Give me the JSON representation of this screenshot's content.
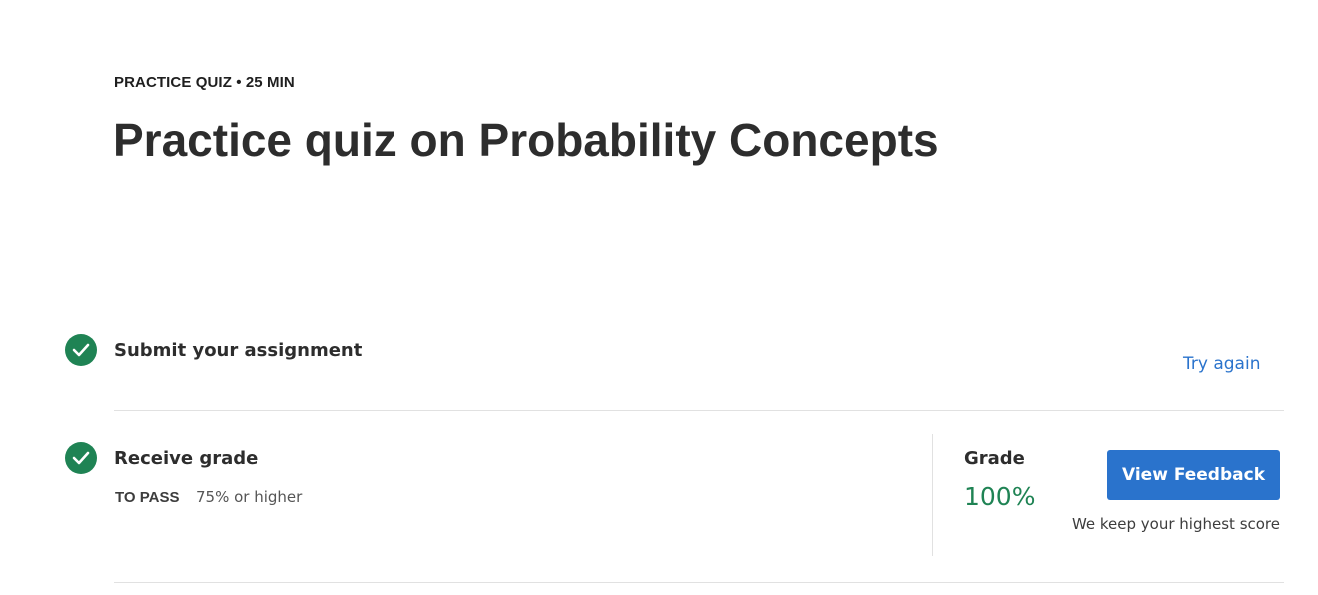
{
  "header": {
    "meta": "PRACTICE QUIZ • 25 MIN",
    "title": "Practice quiz on Probability Concepts"
  },
  "steps": [
    {
      "title": "Submit your assignment",
      "status_icon": "check-circle-icon",
      "action_label": "Try again"
    },
    {
      "title": "Receive grade",
      "status_icon": "check-circle-icon",
      "pass_label": "TO PASS",
      "pass_value": "75% or higher"
    }
  ],
  "grade": {
    "label": "Grade",
    "value": "100%",
    "button_label": "View Feedback",
    "note": "We keep your highest score"
  },
  "colors": {
    "success": "#1f8354",
    "accent": "#2a73cc",
    "text": "#2d2d2d"
  }
}
